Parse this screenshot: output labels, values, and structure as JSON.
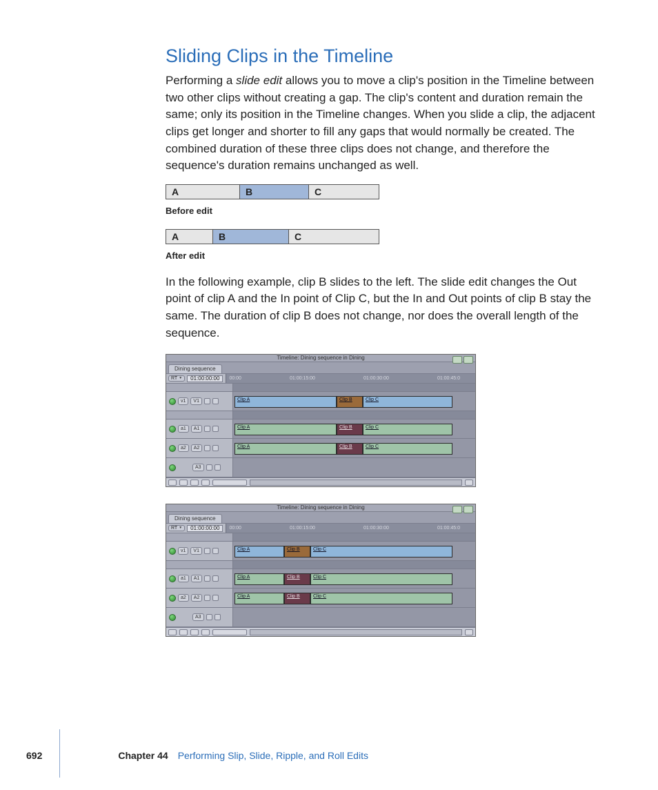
{
  "heading": "Sliding Clips in the Timeline",
  "para1_a": "Performing a ",
  "para1_em": "slide edit",
  "para1_b": " allows you to move a clip's position in the Timeline between two other clips without creating a gap. The clip's content and duration remain the same; only its position in the Timeline changes. When you slide a clip, the adjacent clips get longer and shorter to fill any gaps that would normally be created. The combined duration of these three clips does not change, and therefore the sequence's duration remains unchanged as well.",
  "abc": {
    "A": "A",
    "B": "B",
    "C": "C"
  },
  "before_label": "Before edit",
  "after_label": "After edit",
  "para2": "In the following example, clip B slides to the left. The slide edit changes the Out point of clip A and the In point of Clip C, but the In and Out points of clip B stay the same. The duration of clip B does not change, nor does the overall length of the sequence.",
  "timeline": {
    "window_title": "Timeline: Dining sequence in Dining",
    "tab": "Dining sequence",
    "rt": "RT",
    "timecode": "01:00:00:00",
    "ruler": [
      "00:00",
      "01:00:15:00",
      "01:00:30:00",
      "01:00:45:0"
    ],
    "tracks": {
      "v1_src": "v1",
      "v1_dst": "V1",
      "a1_src": "a1",
      "a1_dst": "A1",
      "a2_src": "a2",
      "a2_dst": "A2",
      "a3_dst": "A3"
    },
    "clips": {
      "A": "Clip A",
      "B": "Clip B",
      "C": "Clip C"
    }
  },
  "footer": {
    "page": "692",
    "chapter_label": "Chapter 44",
    "chapter_title": "Performing Slip, Slide, Ripple, and Roll Edits"
  }
}
